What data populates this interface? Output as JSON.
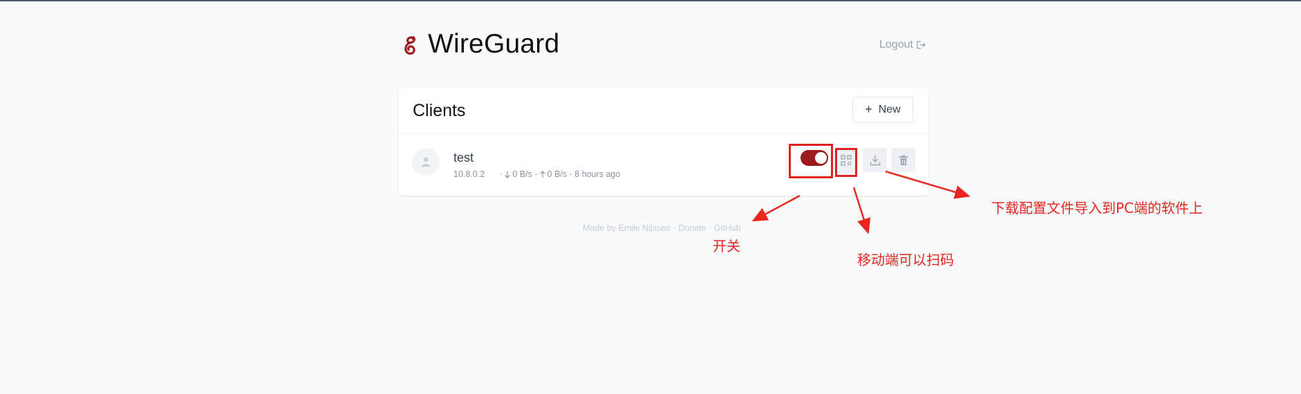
{
  "header": {
    "title": "WireGuard",
    "logout_label": "Logout"
  },
  "clients_card": {
    "title": "Clients",
    "new_button_label": "New",
    "clients": [
      {
        "name": "test",
        "address": "10.8.0.2",
        "separator_1": "·",
        "download_rate": "0 B/s",
        "separator_2": "·",
        "upload_rate": "0 B/s",
        "separator_3": "·",
        "last_seen": "8 hours ago",
        "enabled": true
      }
    ]
  },
  "footer": {
    "text": "Made by Emile Nijssen · Donate · GitHub"
  },
  "annotations": {
    "toggle_note": "开关",
    "qr_note": "移动端可以扫码",
    "download_note": "下载配置文件导入到PC端的软件上"
  },
  "colors": {
    "brand": "#9b1c1c",
    "annotation": "#e8261e",
    "background": "#f8fafc"
  },
  "icons": {
    "logo": "wireguard-dragon-logo",
    "logout": "logout-icon",
    "new": "plus-icon",
    "avatar": "user-icon",
    "download_rate": "arrow-down-icon",
    "upload_rate": "arrow-up-icon",
    "qr": "qr-code-icon",
    "download": "download-icon",
    "delete": "trash-icon"
  }
}
